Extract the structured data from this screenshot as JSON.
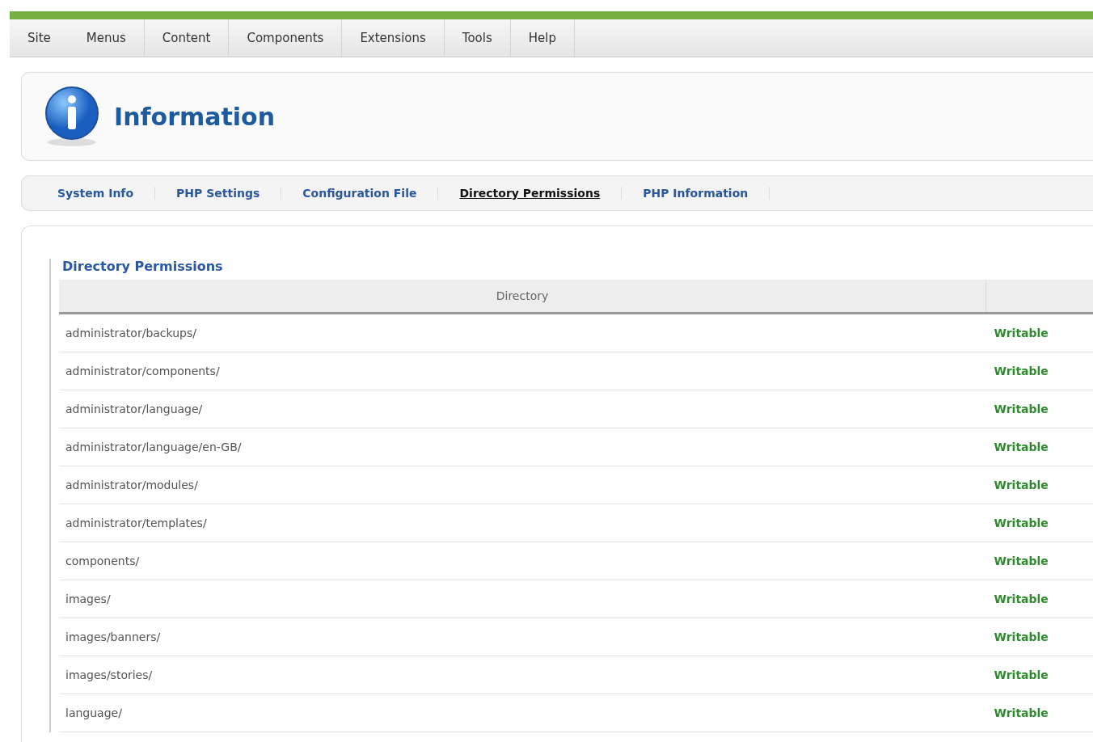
{
  "menu": [
    {
      "label": "Site"
    },
    {
      "label": "Menus"
    },
    {
      "label": "Content"
    },
    {
      "label": "Components"
    },
    {
      "label": "Extensions"
    },
    {
      "label": "Tools"
    },
    {
      "label": "Help"
    }
  ],
  "header": {
    "title": "Information"
  },
  "tabs": [
    {
      "label": "System Info",
      "selected": false
    },
    {
      "label": "PHP Settings",
      "selected": false
    },
    {
      "label": "Configuration File",
      "selected": false
    },
    {
      "label": "Directory Permissions",
      "selected": true
    },
    {
      "label": "PHP Information",
      "selected": false
    }
  ],
  "panel": {
    "legend": "Directory Permissions",
    "table": {
      "columns": [
        "Directory"
      ],
      "rows": [
        {
          "directory": "administrator/backups/",
          "status": "Writable",
          "writable": true
        },
        {
          "directory": "administrator/components/",
          "status": "Writable",
          "writable": true
        },
        {
          "directory": "administrator/language/",
          "status": "Writable",
          "writable": true
        },
        {
          "directory": "administrator/language/en-GB/",
          "status": "Writable",
          "writable": true
        },
        {
          "directory": "administrator/modules/",
          "status": "Writable",
          "writable": true
        },
        {
          "directory": "administrator/templates/",
          "status": "Writable",
          "writable": true
        },
        {
          "directory": "components/",
          "status": "Writable",
          "writable": true
        },
        {
          "directory": "images/",
          "status": "Writable",
          "writable": true
        },
        {
          "directory": "images/banners/",
          "status": "Writable",
          "writable": true
        },
        {
          "directory": "images/stories/",
          "status": "Writable",
          "writable": true
        },
        {
          "directory": "language/",
          "status": "Writable",
          "writable": true
        }
      ]
    }
  }
}
